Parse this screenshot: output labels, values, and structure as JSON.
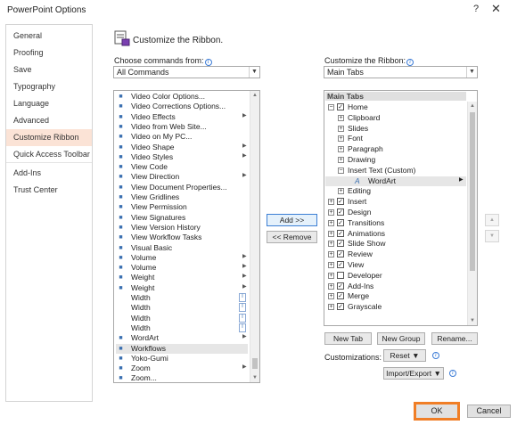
{
  "window": {
    "title": "PowerPoint Options",
    "help": "?",
    "close": "✕"
  },
  "nav": {
    "items": [
      {
        "label": "General"
      },
      {
        "label": "Proofing"
      },
      {
        "label": "Save"
      },
      {
        "label": "Typography"
      },
      {
        "label": "Language"
      },
      {
        "label": "Advanced"
      },
      {
        "label": "Customize Ribbon",
        "active": true
      },
      {
        "label": "Quick Access Toolbar"
      },
      {
        "label": "Add-Ins"
      },
      {
        "label": "Trust Center"
      }
    ]
  },
  "main": {
    "heading": "Customize the Ribbon.",
    "choose_label": "Choose commands from:",
    "choose_value": "All Commands",
    "customize_label": "Customize the Ribbon:",
    "customize_value": "Main Tabs"
  },
  "commands": [
    {
      "label": "Video Color Options...",
      "icon": "video-icon"
    },
    {
      "label": "Video Corrections Options...",
      "icon": "video-corrections-icon"
    },
    {
      "label": "Video Effects",
      "icon": "video-effects-icon",
      "submenu": true
    },
    {
      "label": "Video from Web Site...",
      "icon": "video-web-icon"
    },
    {
      "label": "Video on My PC...",
      "icon": "video-pc-icon"
    },
    {
      "label": "Video Shape",
      "icon": "video-shape-icon",
      "submenu": true
    },
    {
      "label": "Video Styles",
      "icon": "video-styles-icon",
      "submenu": true
    },
    {
      "label": "View Code",
      "icon": "view-code-icon"
    },
    {
      "label": "View Direction",
      "icon": "view-direction-icon",
      "submenu": true
    },
    {
      "label": "View Document Properties...",
      "icon": "document-properties-icon"
    },
    {
      "label": "View Gridlines",
      "icon": "gridlines-icon"
    },
    {
      "label": "View Permission",
      "icon": "permission-icon"
    },
    {
      "label": "View Signatures",
      "icon": "signatures-icon"
    },
    {
      "label": "View Version History",
      "icon": "version-history-icon"
    },
    {
      "label": "View Workflow Tasks",
      "icon": "workflow-tasks-icon"
    },
    {
      "label": "Visual Basic",
      "icon": "visual-basic-icon"
    },
    {
      "label": "Volume",
      "icon": "volume-icon",
      "submenu": true
    },
    {
      "label": "Volume",
      "icon": "volume-icon",
      "submenu": true
    },
    {
      "label": "Weight",
      "icon": "weight-icon",
      "submenu": true
    },
    {
      "label": "Weight",
      "icon": "weight-icon",
      "submenu": true
    },
    {
      "label": "Width",
      "icon": "",
      "mark": "I"
    },
    {
      "label": "Width",
      "icon": "",
      "mark": "I"
    },
    {
      "label": "Width",
      "icon": "",
      "mark": "I"
    },
    {
      "label": "Width",
      "icon": "",
      "mark": "I"
    },
    {
      "label": "WordArt",
      "icon": "wordart-icon",
      "submenu": true
    },
    {
      "label": "Workflows",
      "icon": "workflows-icon",
      "selected": true
    },
    {
      "label": "Yoko-Gumi",
      "icon": "yoko-gumi-icon"
    },
    {
      "label": "Zoom",
      "icon": "zoom-icon",
      "submenu": true
    },
    {
      "label": "Zoom...",
      "icon": "zoom-dialog-icon"
    }
  ],
  "tree": {
    "header": "Main Tabs",
    "rows": [
      {
        "label": "Home",
        "level": 0,
        "expander": "−",
        "checked": true
      },
      {
        "label": "Clipboard",
        "level": 1,
        "expander": "+"
      },
      {
        "label": "Slides",
        "level": 1,
        "expander": "+"
      },
      {
        "label": "Font",
        "level": 1,
        "expander": "+"
      },
      {
        "label": "Paragraph",
        "level": 1,
        "expander": "+"
      },
      {
        "label": "Drawing",
        "level": 1,
        "expander": "+"
      },
      {
        "label": "Insert Text (Custom)",
        "level": 1,
        "expander": "−"
      },
      {
        "label": "WordArt",
        "level": 2,
        "selected": true,
        "submenu": true
      },
      {
        "label": "Editing",
        "level": 1,
        "expander": "+"
      },
      {
        "label": "Insert",
        "level": 0,
        "expander": "+",
        "checked": true
      },
      {
        "label": "Design",
        "level": 0,
        "expander": "+",
        "checked": true
      },
      {
        "label": "Transitions",
        "level": 0,
        "expander": "+",
        "checked": true
      },
      {
        "label": "Animations",
        "level": 0,
        "expander": "+",
        "checked": true
      },
      {
        "label": "Slide Show",
        "level": 0,
        "expander": "+",
        "checked": true
      },
      {
        "label": "Review",
        "level": 0,
        "expander": "+",
        "checked": true
      },
      {
        "label": "View",
        "level": 0,
        "expander": "+",
        "checked": true
      },
      {
        "label": "Developer",
        "level": 0,
        "expander": "+",
        "checked": false
      },
      {
        "label": "Add-Ins",
        "level": 0,
        "expander": "+",
        "checked": true
      },
      {
        "label": "Merge",
        "level": 0,
        "expander": "+",
        "checked": true
      },
      {
        "label": "Grayscale",
        "level": 0,
        "expander": "+",
        "checked": true
      }
    ]
  },
  "buttons": {
    "add": "Add >>",
    "remove": "<< Remove",
    "new_tab": "New Tab",
    "new_group": "New Group",
    "rename": "Rename...",
    "customizations_label": "Customizations:",
    "reset": "Reset",
    "import_export": "Import/Export",
    "ok": "OK",
    "cancel": "Cancel"
  },
  "colors": {
    "accent_orange": "#f07e26",
    "nav_active": "#fbe3d6",
    "link_blue": "#3b7bd6"
  }
}
